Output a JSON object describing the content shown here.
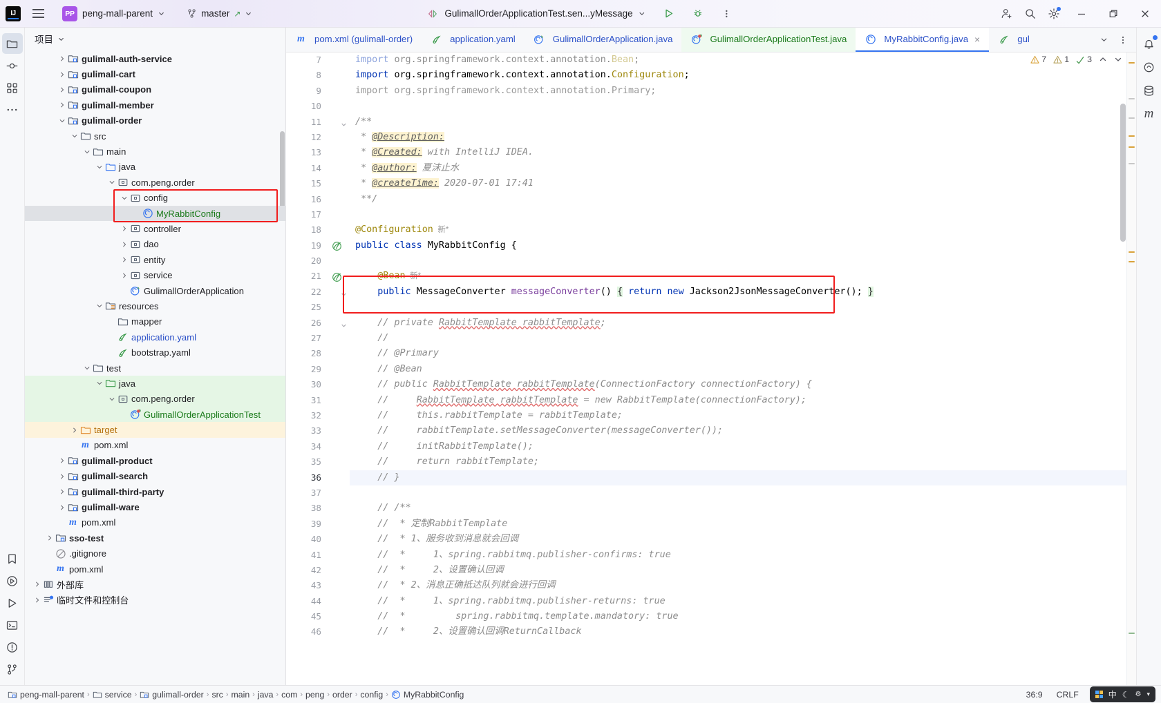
{
  "titlebar": {
    "logo": "IJ",
    "menu_icon": "hamburger-icon",
    "project_badge": "PP",
    "project_name": "peng-mall-parent",
    "vcs_icon": "branch-icon",
    "branch_name": "master",
    "run_config": "GulimallOrderApplicationTest.sen...yMessage",
    "run_label": "run-button",
    "debug_label": "debug-button",
    "more_label": "more-actions-button",
    "account_label": "account-button",
    "search_label": "search-everywhere-button",
    "settings_label": "settings-button",
    "minimize_label": "minimize-button",
    "maximize_label": "maximize-button",
    "close_label": "close-button"
  },
  "left_rail": [
    {
      "name": "project-tool-window",
      "icon": "folder-icon",
      "active": true
    },
    {
      "name": "commit-tool-window",
      "icon": "commit-icon",
      "active": false
    },
    {
      "name": "structure-tool-window",
      "icon": "structure-icon",
      "active": false
    },
    {
      "name": "more-tool-windows",
      "icon": "ellipsis-icon",
      "active": false
    }
  ],
  "left_rail_bottom": [
    {
      "name": "bookmarks-tool-window",
      "icon": "bookmarks-icon"
    },
    {
      "name": "run-tool-window",
      "icon": "run-icon"
    },
    {
      "name": "services-tool-window",
      "icon": "play-icon"
    },
    {
      "name": "terminal-tool-window",
      "icon": "terminal-icon"
    },
    {
      "name": "problems-tool-window",
      "icon": "warning-icon"
    },
    {
      "name": "version-control-tool-window",
      "icon": "vcs-icon"
    }
  ],
  "right_rail": [
    {
      "name": "notifications-tool-window",
      "icon": "bell-icon",
      "badge": true
    },
    {
      "name": "ai-assistant-tool-window",
      "icon": "ai-icon"
    },
    {
      "name": "database-tool-window",
      "icon": "database-icon"
    },
    {
      "name": "maven-tool-window",
      "icon": "maven-icon"
    }
  ],
  "project_panel": {
    "title": "项目",
    "tree": [
      {
        "indent": 2,
        "twisty": "collapsed",
        "icon": "module-icon",
        "label": "gulimall-auth-service",
        "bold": true,
        "color": "default"
      },
      {
        "indent": 2,
        "twisty": "collapsed",
        "icon": "module-icon",
        "label": "gulimall-cart",
        "bold": true,
        "color": "default"
      },
      {
        "indent": 2,
        "twisty": "collapsed",
        "icon": "module-icon",
        "label": "gulimall-coupon",
        "bold": true,
        "color": "default"
      },
      {
        "indent": 2,
        "twisty": "collapsed",
        "icon": "module-icon",
        "label": "gulimall-member",
        "bold": true,
        "color": "default"
      },
      {
        "indent": 2,
        "twisty": "expanded",
        "icon": "module-icon",
        "label": "gulimall-order",
        "bold": true,
        "color": "default"
      },
      {
        "indent": 3,
        "twisty": "expanded",
        "icon": "folder-icon",
        "label": "src",
        "bold": false,
        "color": "default"
      },
      {
        "indent": 4,
        "twisty": "expanded",
        "icon": "folder-icon",
        "label": "main",
        "bold": false,
        "color": "default"
      },
      {
        "indent": 5,
        "twisty": "expanded",
        "icon": "source-folder-icon",
        "label": "java",
        "bold": false,
        "color": "default"
      },
      {
        "indent": 6,
        "twisty": "expanded",
        "icon": "package-icon",
        "label": "com.peng.order",
        "bold": false,
        "color": "default"
      },
      {
        "indent": 7,
        "twisty": "expanded",
        "icon": "package-icon",
        "label": "config",
        "bold": false,
        "color": "default",
        "boxed": true
      },
      {
        "indent": 8,
        "twisty": "none",
        "icon": "class-icon",
        "label": "MyRabbitConfig",
        "bold": false,
        "color": "green",
        "selected": true,
        "boxed": true
      },
      {
        "indent": 7,
        "twisty": "collapsed",
        "icon": "package-icon",
        "label": "controller",
        "bold": false,
        "color": "default"
      },
      {
        "indent": 7,
        "twisty": "collapsed",
        "icon": "package-icon",
        "label": "dao",
        "bold": false,
        "color": "default"
      },
      {
        "indent": 7,
        "twisty": "collapsed",
        "icon": "package-icon",
        "label": "entity",
        "bold": false,
        "color": "default"
      },
      {
        "indent": 7,
        "twisty": "collapsed",
        "icon": "package-icon",
        "label": "service",
        "bold": false,
        "color": "default"
      },
      {
        "indent": 7,
        "twisty": "none",
        "icon": "spring-class-icon",
        "label": "GulimallOrderApplication",
        "bold": false,
        "color": "default"
      },
      {
        "indent": 5,
        "twisty": "expanded",
        "icon": "resources-folder-icon",
        "label": "resources",
        "bold": false,
        "color": "default"
      },
      {
        "indent": 6,
        "twisty": "none",
        "icon": "folder-icon",
        "label": "mapper",
        "bold": false,
        "color": "default"
      },
      {
        "indent": 6,
        "twisty": "none",
        "icon": "yaml-icon",
        "label": "application.yaml",
        "bold": false,
        "color": "blue"
      },
      {
        "indent": 6,
        "twisty": "none",
        "icon": "yaml-icon",
        "label": "bootstrap.yaml",
        "bold": false,
        "color": "default"
      },
      {
        "indent": 4,
        "twisty": "expanded",
        "icon": "folder-icon",
        "label": "test",
        "bold": false,
        "color": "default"
      },
      {
        "indent": 5,
        "twisty": "expanded",
        "icon": "test-source-folder-icon",
        "label": "java",
        "bold": false,
        "color": "default",
        "row": "green"
      },
      {
        "indent": 6,
        "twisty": "expanded",
        "icon": "package-icon",
        "label": "com.peng.order",
        "bold": false,
        "color": "default",
        "row": "green"
      },
      {
        "indent": 7,
        "twisty": "none",
        "icon": "test-class-icon",
        "label": "GulimallOrderApplicationTest",
        "bold": false,
        "color": "green",
        "row": "green"
      },
      {
        "indent": 3,
        "twisty": "collapsed",
        "icon": "excluded-folder-icon",
        "label": "target",
        "bold": false,
        "color": "orange",
        "row": "orange"
      },
      {
        "indent": 3,
        "twisty": "none",
        "icon": "maven-icon",
        "label": "pom.xml",
        "bold": false,
        "color": "default"
      },
      {
        "indent": 2,
        "twisty": "collapsed",
        "icon": "module-icon",
        "label": "gulimall-product",
        "bold": true,
        "color": "default"
      },
      {
        "indent": 2,
        "twisty": "collapsed",
        "icon": "module-icon",
        "label": "gulimall-search",
        "bold": true,
        "color": "default"
      },
      {
        "indent": 2,
        "twisty": "collapsed",
        "icon": "module-icon",
        "label": "gulimall-third-party",
        "bold": true,
        "color": "default"
      },
      {
        "indent": 2,
        "twisty": "collapsed",
        "icon": "module-icon",
        "label": "gulimall-ware",
        "bold": true,
        "color": "default"
      },
      {
        "indent": 2,
        "twisty": "none",
        "icon": "maven-icon",
        "label": "pom.xml",
        "bold": false,
        "color": "default"
      },
      {
        "indent": 1,
        "twisty": "collapsed",
        "icon": "module-icon",
        "label": "sso-test",
        "bold": true,
        "color": "default"
      },
      {
        "indent": 1,
        "twisty": "none",
        "icon": "gitignore-icon",
        "label": ".gitignore",
        "bold": false,
        "color": "default"
      },
      {
        "indent": 1,
        "twisty": "none",
        "icon": "maven-icon",
        "label": "pom.xml",
        "bold": false,
        "color": "default"
      },
      {
        "indent": 0,
        "twisty": "collapsed",
        "icon": "library-icon",
        "label": "外部库",
        "bold": false,
        "color": "default"
      },
      {
        "indent": 0,
        "twisty": "collapsed",
        "icon": "scratches-icon",
        "label": "临时文件和控制台",
        "bold": false,
        "color": "default"
      }
    ]
  },
  "editor_tabs": [
    {
      "label": "pom.xml (gulimall-order)",
      "icon": "maven-icon",
      "color": "blue",
      "state": "normal"
    },
    {
      "label": "application.yaml",
      "icon": "yaml-icon",
      "color": "blue",
      "state": "normal"
    },
    {
      "label": "GulimallOrderApplication.java",
      "icon": "spring-class-icon",
      "color": "blue",
      "state": "normal"
    },
    {
      "label": "GulimallOrderApplicationTest.java",
      "icon": "test-class-icon",
      "color": "green",
      "state": "running"
    },
    {
      "label": "MyRabbitConfig.java",
      "icon": "class-icon",
      "color": "blue",
      "state": "selected",
      "close": "×"
    },
    {
      "label": "gul",
      "icon": "yaml-icon",
      "color": "blue",
      "state": "truncated"
    }
  ],
  "editor_tabs_actions": [
    {
      "name": "tab-list-button",
      "icon": "chevron-down-icon"
    },
    {
      "name": "tab-options-button",
      "icon": "ellipsis-vertical-icon"
    }
  ],
  "inspection_widget": {
    "warnings_count": "7",
    "weak_warnings_count": "1",
    "typos_count": "3",
    "prev_icon": "chevron-up-icon",
    "next_icon": "chevron-down-icon"
  },
  "code": {
    "first_line": 7,
    "cursor_line": 36,
    "lines": [
      {
        "n": 7,
        "html": "<span class='kw'>import</span> <span class='plain'>org.springframework.context.annotation.</span><span class='ann'>Bean</span><span class='plain'>;</span>",
        "clip": true
      },
      {
        "n": 8,
        "html": "<span class='kw'>import</span> <span class='plain'>org.springframework.context.annotation.</span><span class='ann'>Configuration</span><span class='plain'>;</span>"
      },
      {
        "n": 9,
        "html": "<span class='grey'>import org.springframework.context.annotation.Primary;</span>"
      },
      {
        "n": 10,
        "html": ""
      },
      {
        "n": 11,
        "html": "<span class='jdoc-txt'>/**</span>",
        "fold": true
      },
      {
        "n": 12,
        "html": " <span class='jdoc-txt'>* </span><span class='jdoc-tag'>@Description:</span>"
      },
      {
        "n": 13,
        "html": " <span class='jdoc-txt'>* </span><span class='jdoc-tag'>@Created:</span><span class='jdoc-txt'> with IntelliJ IDEA.</span>"
      },
      {
        "n": 14,
        "html": " <span class='jdoc-txt'>* </span><span class='jdoc-tag'>@author:</span><span class='jdoc-txt'> 夏沫止水</span>"
      },
      {
        "n": 15,
        "html": " <span class='jdoc-txt'>* </span><span class='jdoc-tag'>@createTime:</span><span class='jdoc-txt'> 2020-07-01 17:41</span>"
      },
      {
        "n": 16,
        "html": " <span class='jdoc-txt'>**/</span>"
      },
      {
        "n": 17,
        "html": ""
      },
      {
        "n": 18,
        "html": "<span class='ann'>@Configuration</span><span class='hintinline'>  新*</span>"
      },
      {
        "n": 19,
        "html": "<span class='kw'>public</span> <span class='kw'>class</span> <span class='plain'>MyRabbitConfig {</span>",
        "bean": true
      },
      {
        "n": 20,
        "html": ""
      },
      {
        "n": 21,
        "html": "    <span class='ann'>@Bean</span><span class='hintinline'>  新*</span>",
        "bean": true
      },
      {
        "n": 22,
        "html": "    <span class='kw'>public</span> <span class='plain'>MessageConverter </span><span class='method'>messageConverter</span><span class='plain'>()</span> <span class='bracehl'>{</span> <span class='kw'>return</span> <span class='kw'>new</span> <span class='plain'>Jackson2JsonMessageConverter();</span> <span class='bracehl'>}</span>",
        "fold": true
      },
      {
        "n": 25,
        "html": ""
      },
      {
        "n": 26,
        "html": "    <span class='cmt'>// private <span class='squig'>RabbitTemplate rabbitTemplate</span>;</span>",
        "fold": true
      },
      {
        "n": 27,
        "html": "    <span class='cmt'>//</span>"
      },
      {
        "n": 28,
        "html": "    <span class='cmt'>// @Primary</span>"
      },
      {
        "n": 29,
        "html": "    <span class='cmt'>// @Bean</span>"
      },
      {
        "n": 30,
        "html": "    <span class='cmt'>// public <span class='squig'>RabbitTemplate rabbitTemplate</span>(ConnectionFactory connectionFactory) {</span>"
      },
      {
        "n": 31,
        "html": "    <span class='cmt'>//     <span class='squig'>RabbitTemplate rabbitTemplate</span> = new RabbitTemplate(connectionFactory);</span>"
      },
      {
        "n": 32,
        "html": "    <span class='cmt'>//     this.rabbitTemplate = rabbitTemplate;</span>"
      },
      {
        "n": 33,
        "html": "    <span class='cmt'>//     rabbitTemplate.setMessageConverter(messageConverter());</span>"
      },
      {
        "n": 34,
        "html": "    <span class='cmt'>//     initRabbitTemplate();</span>"
      },
      {
        "n": 35,
        "html": "    <span class='cmt'>//     return rabbitTemplate;</span>"
      },
      {
        "n": 36,
        "html": "    <span class='cmt'>// }</span>",
        "cursor": true
      },
      {
        "n": 37,
        "html": ""
      },
      {
        "n": 38,
        "html": "    <span class='cmt'>// /**</span>"
      },
      {
        "n": 39,
        "html": "    <span class='cmt'>//  * 定制RabbitTemplate</span>"
      },
      {
        "n": 40,
        "html": "    <span class='cmt'>//  * 1、服务收到消息就会回调</span>"
      },
      {
        "n": 41,
        "html": "    <span class='cmt'>//  *     1、spring.rabbitmq.publisher-confirms: true</span>"
      },
      {
        "n": 42,
        "html": "    <span class='cmt'>//  *     2、设置确认回调</span>"
      },
      {
        "n": 43,
        "html": "    <span class='cmt'>//  * 2、消息正确抵达队列就会进行回调</span>"
      },
      {
        "n": 44,
        "html": "    <span class='cmt'>//  *     1、spring.rabbitmq.publisher-returns: true</span>"
      },
      {
        "n": 45,
        "html": "    <span class='cmt'>//  *         spring.rabbitmq.template.mandatory: true</span>"
      },
      {
        "n": 46,
        "html": "    <span class='cmt'>//  *     2、设置确认回调ReturnCallback</span>"
      }
    ]
  },
  "status_bar": {
    "breadcrumbs": [
      {
        "label": "peng-mall-parent",
        "icon": "module-icon"
      },
      {
        "label": "service",
        "icon": "folder-icon"
      },
      {
        "label": "gulimall-order",
        "icon": "module-icon"
      },
      {
        "label": "src",
        "icon": "none"
      },
      {
        "label": "main",
        "icon": "none"
      },
      {
        "label": "java",
        "icon": "none"
      },
      {
        "label": "com",
        "icon": "none"
      },
      {
        "label": "peng",
        "icon": "none"
      },
      {
        "label": "order",
        "icon": "none"
      },
      {
        "label": "config",
        "icon": "none"
      },
      {
        "label": "MyRabbitConfig",
        "icon": "class-icon"
      }
    ],
    "caret_position": "36:9",
    "line_separator": "CRLF",
    "ime_text": "中",
    "ime_icons": [
      "keyboard-icon",
      "moon-icon",
      "settings-icon",
      "chevron-icon"
    ]
  }
}
